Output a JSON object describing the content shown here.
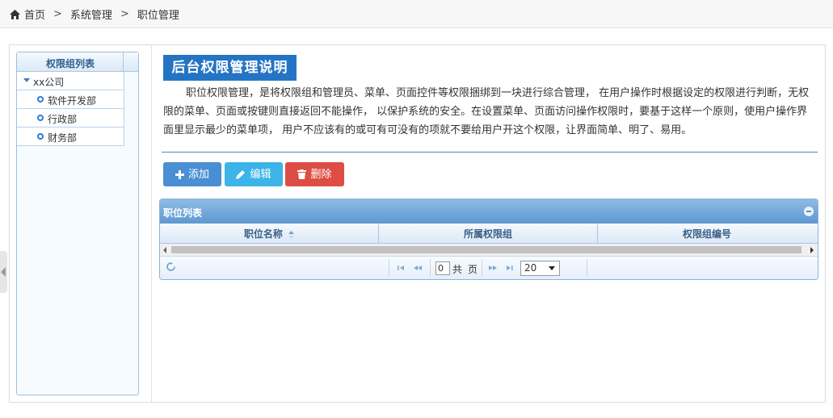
{
  "breadcrumb": {
    "home": "首页",
    "level1": "系统管理",
    "level2": "职位管理",
    "separator": ">"
  },
  "tree": {
    "title": "权限组列表",
    "root": "xx公司",
    "children": [
      "软件开发部",
      "行政部",
      "财务部"
    ]
  },
  "notice": {
    "title": "后台权限管理说明",
    "text": "职位权限管理，是将权限组和管理员、菜单、页面控件等权限捆绑到一块进行综合管理， 在用户操作时根据设定的权限进行判断，无权限的菜单、页面或按键则直接返回不能操作， 以保护系统的安全。在设置菜单、页面访问操作权限时，要基于这样一个原则，使用户操作界面里显示最少的菜单项， 用户不应该有的或可有可没有的项就不要给用户开这个权限，让界面简单、明了、易用。"
  },
  "toolbar": {
    "add": "添加",
    "edit": "编辑",
    "delete": "删除"
  },
  "colors": {
    "primary": "#2574c4",
    "add": "#4a8fd4",
    "edit": "#3cb4e8",
    "delete": "#dd4d44"
  },
  "grid": {
    "caption": "职位列表",
    "columns": [
      "职位名称",
      "所属权限组",
      "权限组编号"
    ],
    "pager": {
      "page": "0",
      "total_prefix": "共",
      "total_suffix": "页",
      "page_size": "20"
    }
  }
}
